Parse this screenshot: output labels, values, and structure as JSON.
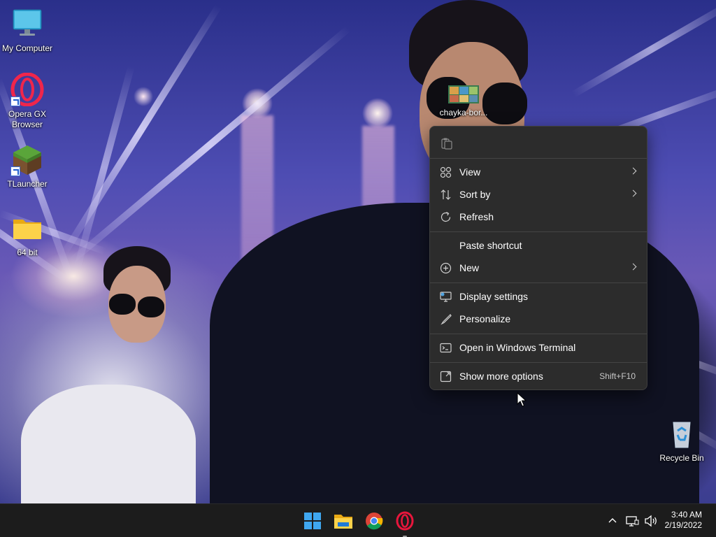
{
  "desktop": {
    "icons": [
      {
        "label": "My Computer",
        "icon": "monitor-icon"
      },
      {
        "label": "Opera GX\nBrowser",
        "icon": "opera-gx-icon"
      },
      {
        "label": "TLauncher",
        "icon": "minecraft-grass-block-icon"
      },
      {
        "label": "64 bit",
        "icon": "folder-icon"
      },
      {
        "label": "chayka-bor...",
        "icon": "image-thumbnail-icon"
      },
      {
        "label": "Recycle Bin",
        "icon": "recycle-bin-icon"
      }
    ]
  },
  "context_menu": {
    "toolbar_icon": "paste-icon",
    "items": [
      {
        "label": "View",
        "icon": "grid-icon",
        "submenu": true
      },
      {
        "label": "Sort by",
        "icon": "sort-icon",
        "submenu": true
      },
      {
        "label": "Refresh",
        "icon": "refresh-icon",
        "submenu": false
      },
      {
        "label": "Paste shortcut",
        "icon": "",
        "submenu": false
      },
      {
        "label": "New",
        "icon": "plus-circle-icon",
        "submenu": true
      },
      {
        "label": "Display settings",
        "icon": "display-settings-icon",
        "submenu": false
      },
      {
        "label": "Personalize",
        "icon": "brush-icon",
        "submenu": false
      },
      {
        "label": "Open in Windows Terminal",
        "icon": "terminal-icon",
        "submenu": false
      },
      {
        "label": "Show more options",
        "icon": "expand-icon",
        "shortcut": "Shift+F10"
      }
    ]
  },
  "taskbar": {
    "apps": [
      "start-icon",
      "file-explorer-icon",
      "chrome-icon",
      "opera-icon"
    ],
    "tray": [
      "chevron-up-icon",
      "network-icon",
      "volume-icon"
    ],
    "time": "3:40 AM",
    "date": "2/19/2022"
  },
  "colors": {
    "menu_bg": "#2c2c2c",
    "taskbar_bg": "#1c1c1c",
    "accent": "#0078d4"
  }
}
